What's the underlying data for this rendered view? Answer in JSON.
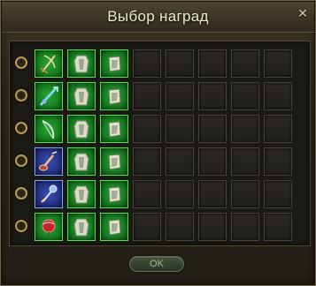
{
  "window": {
    "title": "Выбор наград",
    "close_glyph": "✕"
  },
  "rows": [
    {
      "weapon": "bow-icon"
    },
    {
      "weapon": "staff-icon"
    },
    {
      "weapon": "longbow-icon"
    },
    {
      "weapon": "guitar-icon"
    },
    {
      "weapon": "orb-icon"
    },
    {
      "weapon": "rose-icon"
    }
  ],
  "footer": {
    "ok_label": "OK"
  },
  "colors": {
    "accent_green": "#2ea838",
    "weapon_blue": "#3d4fb5"
  }
}
